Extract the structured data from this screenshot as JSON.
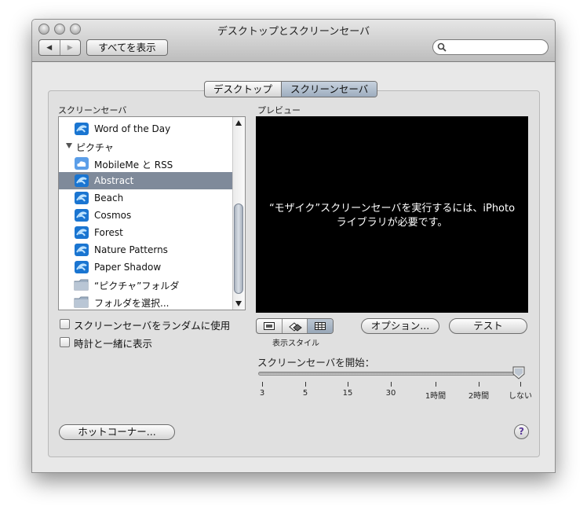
{
  "window": {
    "title": "デスクトップとスクリーンセーバ"
  },
  "toolbar": {
    "back_icon": "◀",
    "forward_icon": "▶",
    "show_all_label": "すべてを表示",
    "search_placeholder": ""
  },
  "tabs": [
    {
      "label": "デスクトップ",
      "selected": false
    },
    {
      "label": "スクリーンセーバ",
      "selected": true
    }
  ],
  "screensavers": {
    "header": "スクリーンセーバ",
    "items": [
      {
        "label": "Word of the Day",
        "icon": "screensaver-swirl"
      },
      {
        "label": "ピクチャ",
        "icon": "disclosure-triangle"
      },
      {
        "label": "MobileMe と RSS",
        "icon": "mobileme-cloud"
      },
      {
        "label": "Abstract",
        "icon": "screensaver-swirl",
        "selected": true
      },
      {
        "label": "Beach",
        "icon": "screensaver-swirl"
      },
      {
        "label": "Cosmos",
        "icon": "screensaver-swirl"
      },
      {
        "label": "Forest",
        "icon": "screensaver-swirl"
      },
      {
        "label": "Nature Patterns",
        "icon": "screensaver-swirl"
      },
      {
        "label": "Paper Shadow",
        "icon": "screensaver-swirl"
      },
      {
        "label": "“ピクチャ”フォルダ",
        "icon": "folder"
      },
      {
        "label": "フォルダを選択...",
        "icon": "folder"
      }
    ]
  },
  "preview": {
    "header": "プレビュー",
    "message_line1": "“モザイク”スクリーンセーバを実行するには、iPhoto",
    "message_line2": "ライブラリが必要です。"
  },
  "options": {
    "random_label": "スクリーンセーバをランダムに使用",
    "random_checked": false,
    "clock_label": "時計と一緒に表示",
    "clock_checked": false
  },
  "display_style": {
    "label": "表示スタイル",
    "selected_index": 2
  },
  "buttons": {
    "options_label": "オプション...",
    "test_label": "テスト",
    "hot_corners_label": "ホットコーナー...",
    "help_label": "?"
  },
  "start": {
    "label": "スクリーンセーバを開始：",
    "ticks": [
      "3",
      "5",
      "15",
      "30",
      "1時間",
      "2時間",
      "しない"
    ],
    "value": "しない"
  },
  "colors": {
    "selection": "#7f8a9a",
    "preview_bg": "#000000",
    "help_glyph": "#5b3a9a"
  }
}
